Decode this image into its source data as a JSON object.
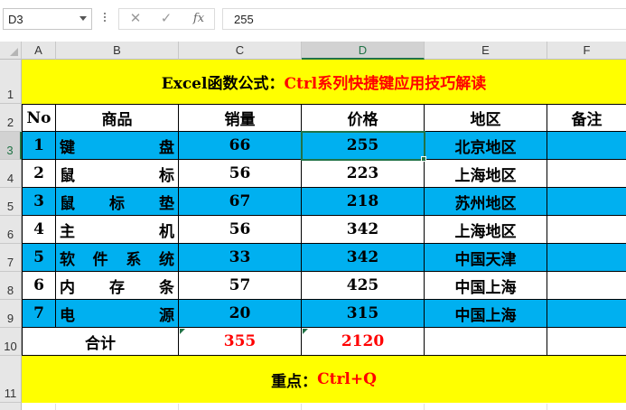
{
  "formula_bar": {
    "name_box": "D3",
    "cancel_icon": "✕",
    "enter_icon": "✓",
    "function_label": "fx",
    "formula_value": "255"
  },
  "columns": [
    "A",
    "B",
    "C",
    "D",
    "E",
    "F"
  ],
  "rows": [
    "1",
    "2",
    "3",
    "4",
    "5",
    "6",
    "7",
    "8",
    "9",
    "10",
    "11"
  ],
  "title": {
    "prefix": "Excel函数公式：",
    "highlight": "Ctrl系列快捷键应用技巧解读"
  },
  "table": {
    "headers": [
      "No",
      "商品",
      "销量",
      "价格",
      "地区",
      "备注"
    ],
    "rows": [
      {
        "no": "1",
        "product": [
          "键",
          "盘"
        ],
        "sales": "66",
        "price": "255",
        "region": "北京地区",
        "note": ""
      },
      {
        "no": "2",
        "product": [
          "鼠",
          "标"
        ],
        "sales": "56",
        "price": "223",
        "region": "上海地区",
        "note": ""
      },
      {
        "no": "3",
        "product": [
          "鼠",
          "标",
          "垫"
        ],
        "sales": "67",
        "price": "218",
        "region": "苏州地区",
        "note": ""
      },
      {
        "no": "4",
        "product": [
          "主",
          "机"
        ],
        "sales": "56",
        "price": "342",
        "region": "上海地区",
        "note": ""
      },
      {
        "no": "5",
        "product": [
          "软",
          "件",
          "系",
          "统"
        ],
        "sales": "33",
        "price": "342",
        "region": "中国天津",
        "note": ""
      },
      {
        "no": "6",
        "product": [
          "内",
          "存",
          "条"
        ],
        "sales": "57",
        "price": "425",
        "region": "中国上海",
        "note": ""
      },
      {
        "no": "7",
        "product": [
          "电",
          "源"
        ],
        "sales": "20",
        "price": "315",
        "region": "中国上海",
        "note": ""
      }
    ],
    "total": {
      "label": "合计",
      "sales": "355",
      "price": "2120"
    }
  },
  "footer": {
    "prefix": "重点：",
    "highlight": "Ctrl+Q"
  },
  "colors": {
    "banner": "#ffff00",
    "row_blue": "#00b0f0",
    "accent_red": "#ff0000",
    "selection_green": "#217346"
  }
}
